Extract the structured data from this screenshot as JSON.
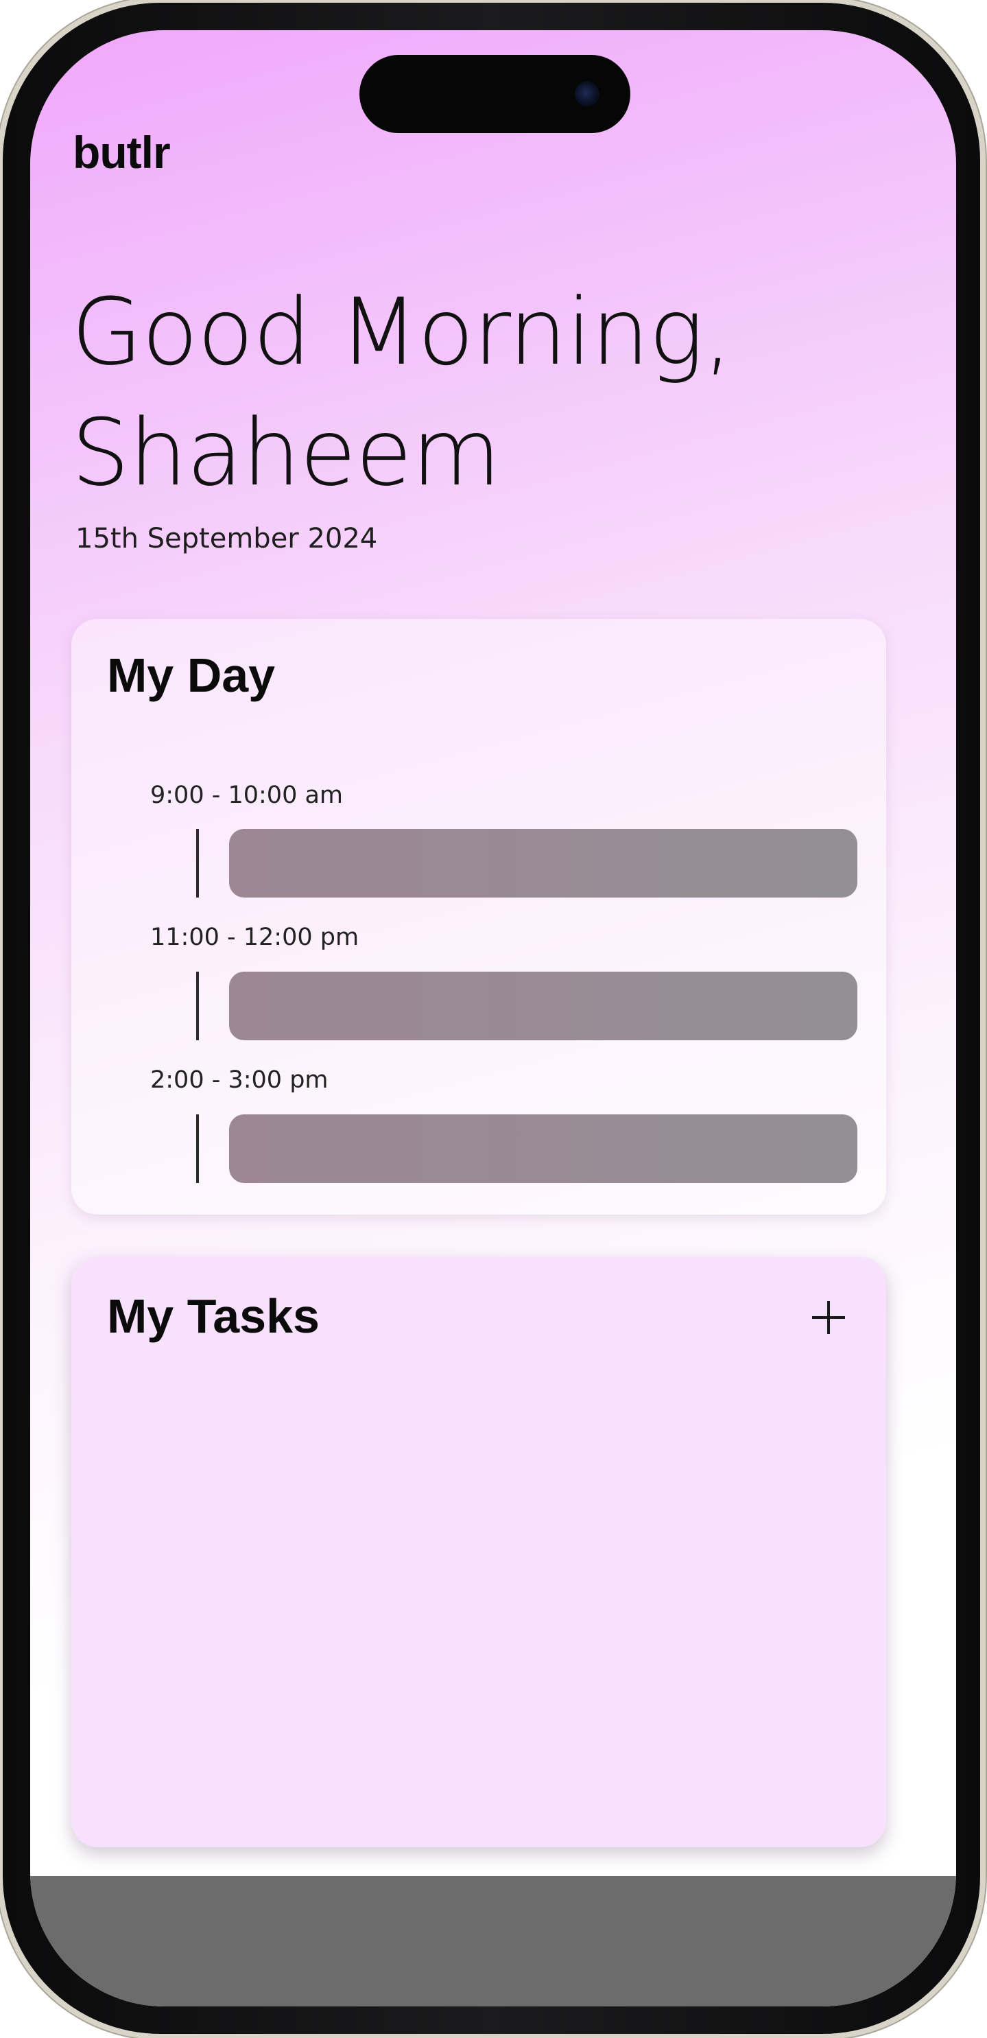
{
  "app": {
    "brand": "butlr"
  },
  "header": {
    "greeting_line1": "Good Morning,",
    "greeting_line2": "Shaheem",
    "date": "15th September 2024"
  },
  "my_day": {
    "title": "My Day",
    "slots": [
      {
        "time": "9:00 - 10:00 am"
      },
      {
        "time": "11:00 - 12:00 pm"
      },
      {
        "time": "2:00 - 3:00 pm"
      }
    ]
  },
  "my_tasks": {
    "title": "My Tasks",
    "add_icon": "plus-icon"
  },
  "colors": {
    "gradient_top": "#f0a8fb",
    "card_tasks_bg": "#f8e1fc",
    "event_block": "#9a8b95",
    "bottom_bar": "#6c6c6c"
  }
}
